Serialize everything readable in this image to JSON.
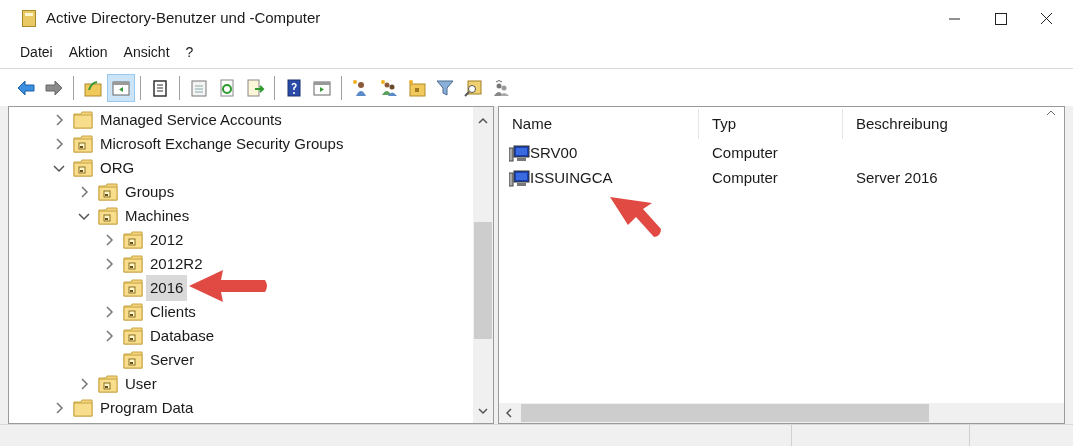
{
  "window": {
    "title": "Active Directory-Benutzer und -Computer"
  },
  "menu": [
    "Datei",
    "Aktion",
    "Ansicht",
    "?"
  ],
  "toolbar": [
    [
      {
        "pressed": false
      },
      {
        "pressed": false
      }
    ],
    [
      {
        "pressed": false
      },
      {
        "pressed": true
      }
    ],
    [
      {
        "pressed": false
      }
    ],
    [
      {
        "pressed": false
      },
      {
        "pressed": false
      },
      {
        "pressed": false
      }
    ],
    [
      {
        "pressed": false
      },
      {
        "pressed": false
      }
    ],
    [
      {
        "pressed": false
      },
      {
        "pressed": false
      },
      {
        "pressed": false
      },
      {
        "pressed": false
      },
      {
        "pressed": false
      },
      {
        "pressed": false
      }
    ]
  ],
  "tree": [
    {
      "label": "Managed Service Accounts",
      "kind": "folder",
      "expanded": false,
      "selected": false
    },
    {
      "label": "Microsoft Exchange Security Groups",
      "kind": "ou",
      "expanded": false,
      "selected": false
    },
    {
      "label": "ORG",
      "kind": "ou",
      "expanded": true,
      "selected": false,
      "children": [
        {
          "label": "Groups",
          "kind": "ou",
          "expanded": false,
          "selected": false
        },
        {
          "label": "Machines",
          "kind": "ou",
          "expanded": true,
          "selected": false,
          "children": [
            {
              "label": "2012",
              "kind": "ou",
              "expanded": false,
              "selected": false
            },
            {
              "label": "2012R2",
              "kind": "ou",
              "expanded": false,
              "selected": false
            },
            {
              "label": "2016",
              "kind": "ou",
              "selected": true
            },
            {
              "label": "Clients",
              "kind": "ou",
              "expanded": false,
              "selected": false
            },
            {
              "label": "Database",
              "kind": "ou",
              "expanded": false,
              "selected": false
            },
            {
              "label": "Server",
              "kind": "ou",
              "selected": false
            }
          ]
        },
        {
          "label": "User",
          "kind": "ou",
          "expanded": false,
          "selected": false
        }
      ]
    },
    {
      "label": "Program Data",
      "kind": "folder",
      "expanded": false,
      "selected": false
    }
  ],
  "table": {
    "columns": [
      "Name",
      "Typ",
      "Beschreibung"
    ],
    "rows": [
      {
        "name": "SRV00",
        "type": "Computer"
      },
      {
        "name": "ISSUINGCA",
        "type": "Computer",
        "description": "Server 2016"
      }
    ]
  }
}
